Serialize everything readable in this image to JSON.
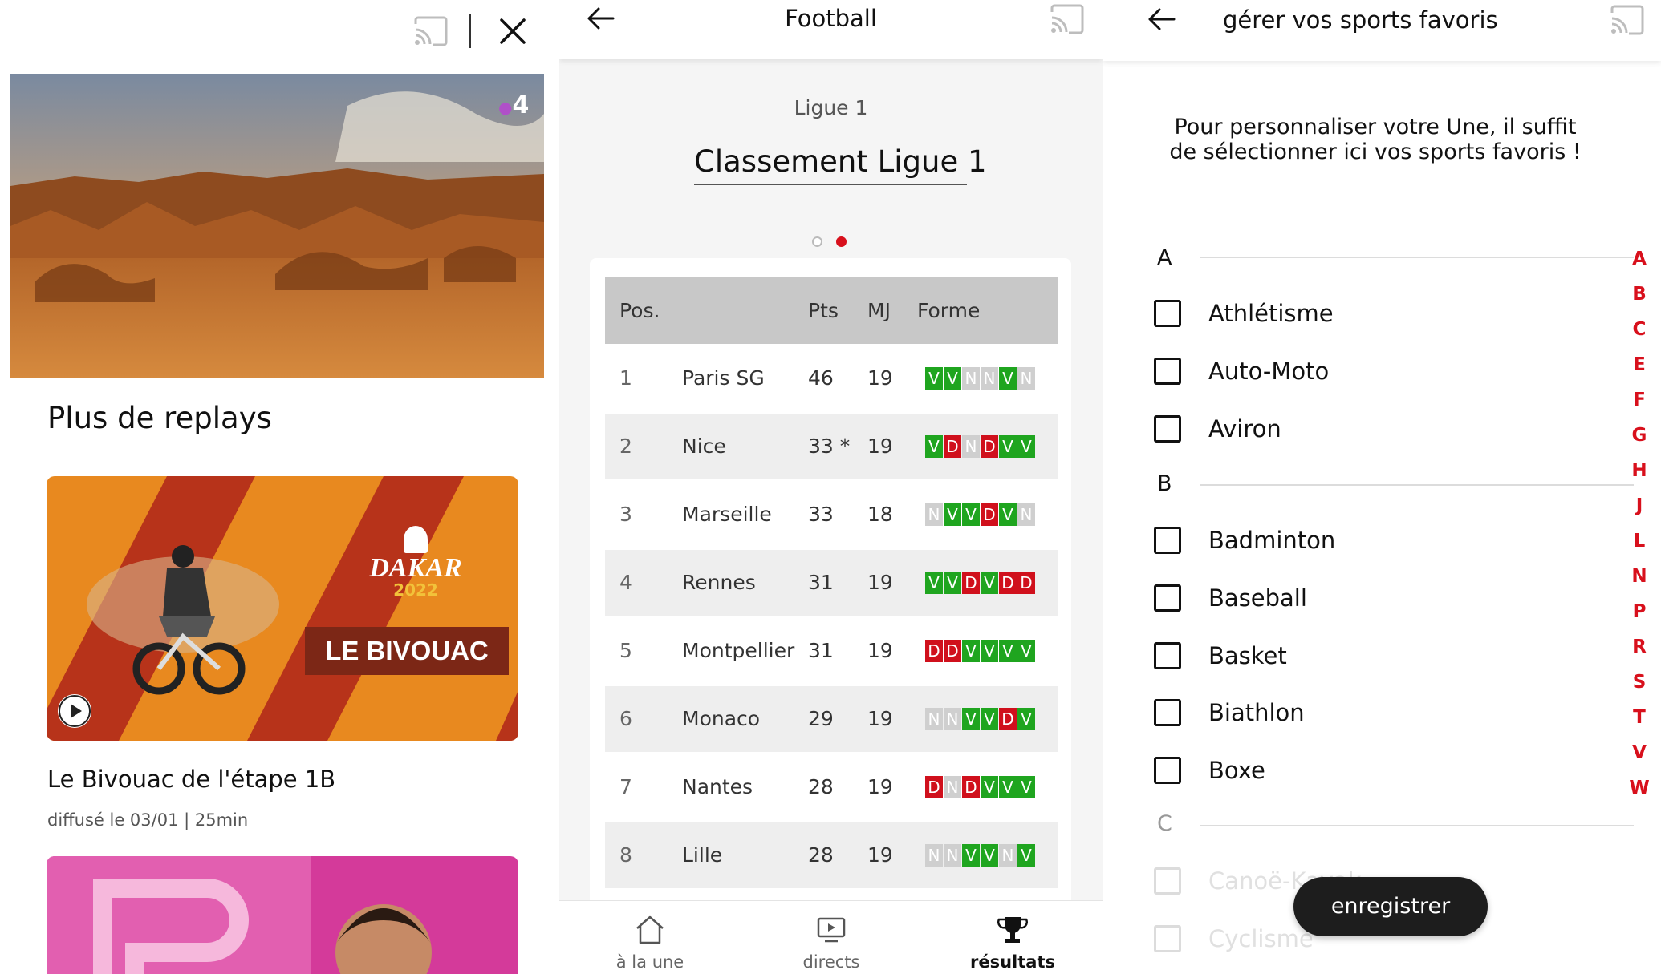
{
  "panel1": {
    "channel_badge": "4",
    "section_title": "Plus de replays",
    "card": {
      "brand": "DAKAR",
      "year": "2022",
      "show": "LE BIVOUAC",
      "title": "Le Bivouac de l'étape 1B",
      "meta": "diffusé le 03/01 | 25min"
    },
    "icons": [
      "cast-icon",
      "close-icon",
      "play-icon"
    ]
  },
  "panel2": {
    "title": "Football",
    "league_label": "Ligue 1",
    "league_title": "Classement Ligue 1",
    "pager": {
      "count": 2,
      "active": 1
    },
    "columns": {
      "pos": "Pos.",
      "pts": "Pts",
      "mj": "MJ",
      "form": "Forme"
    },
    "rows": [
      {
        "pos": "1",
        "team": "Paris SG",
        "pts": "46",
        "mj": "19",
        "form": [
          "V",
          "V",
          "N",
          "N",
          "V",
          "N"
        ]
      },
      {
        "pos": "2",
        "team": "Nice",
        "pts": "33 *",
        "mj": "19",
        "form": [
          "V",
          "D",
          "N",
          "D",
          "V",
          "V"
        ]
      },
      {
        "pos": "3",
        "team": "Marseille",
        "pts": "33",
        "mj": "18",
        "form": [
          "N",
          "V",
          "V",
          "D",
          "V",
          "N"
        ]
      },
      {
        "pos": "4",
        "team": "Rennes",
        "pts": "31",
        "mj": "19",
        "form": [
          "V",
          "V",
          "D",
          "V",
          "D",
          "D"
        ]
      },
      {
        "pos": "5",
        "team": "Montpellier",
        "pts": "31",
        "mj": "19",
        "form": [
          "D",
          "D",
          "V",
          "V",
          "V",
          "V"
        ]
      },
      {
        "pos": "6",
        "team": "Monaco",
        "pts": "29",
        "mj": "19",
        "form": [
          "N",
          "N",
          "V",
          "V",
          "D",
          "V"
        ]
      },
      {
        "pos": "7",
        "team": "Nantes",
        "pts": "28",
        "mj": "19",
        "form": [
          "D",
          "N",
          "D",
          "V",
          "V",
          "V"
        ]
      },
      {
        "pos": "8",
        "team": "Lille",
        "pts": "28",
        "mj": "19",
        "form": [
          "N",
          "N",
          "V",
          "V",
          "N",
          "V"
        ]
      }
    ],
    "form_colors": {
      "V": "#1fa51f",
      "D": "#d0101c",
      "N": "#cfcfcf"
    },
    "nav": [
      {
        "label": "à la une",
        "icon": "home-icon",
        "active": false
      },
      {
        "label": "directs",
        "icon": "live-tv-icon",
        "active": false
      },
      {
        "label": "résultats",
        "icon": "trophy-icon",
        "active": true
      }
    ]
  },
  "panel3": {
    "title": "gérer vos sports favoris",
    "intro": "Pour personnaliser votre Une, il suffit de sélectionner ici vos sports favoris !",
    "letter_a": "A",
    "letter_b": "B",
    "letter_c": "C",
    "sports_a": [
      "Athlétisme",
      "Auto-Moto",
      "Aviron"
    ],
    "sports_b": [
      "Badminton",
      "Baseball",
      "Basket",
      "Biathlon",
      "Boxe"
    ],
    "sports_c": [
      "Canoë-Kayak",
      "Cyclisme"
    ],
    "az_index": [
      "A",
      "B",
      "C",
      "E",
      "F",
      "G",
      "H",
      "J",
      "L",
      "N",
      "P",
      "R",
      "S",
      "T",
      "V",
      "W"
    ],
    "save_label": "enregistrer",
    "accent": "#d8101c"
  }
}
